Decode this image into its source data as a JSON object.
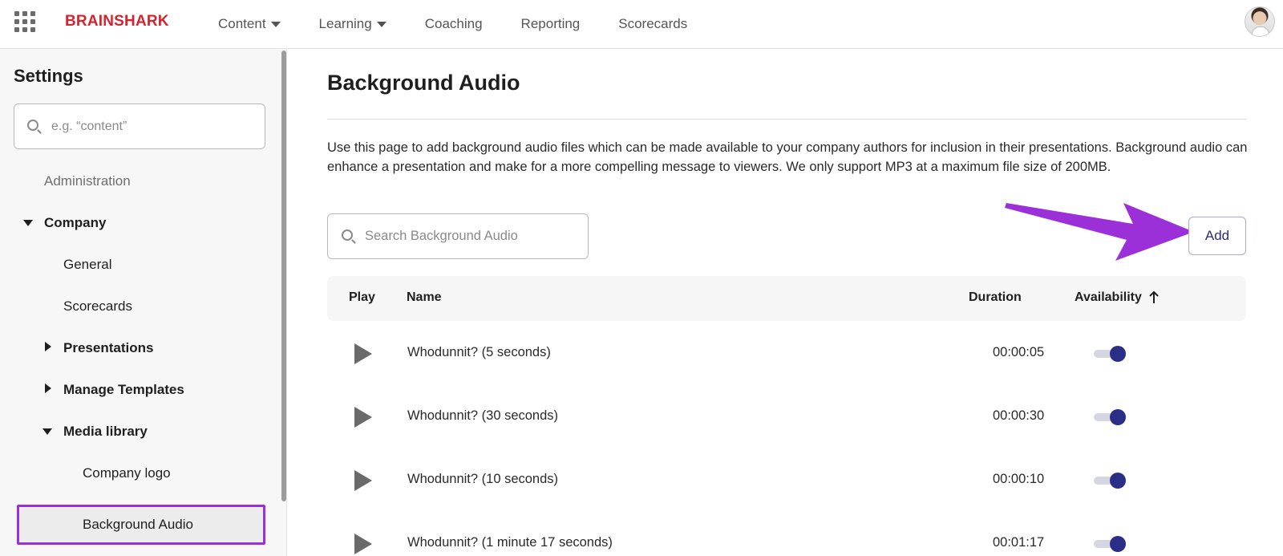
{
  "nav": {
    "brand": "BRAINSHARK",
    "items": [
      {
        "label": "Content",
        "has_caret": true
      },
      {
        "label": "Learning",
        "has_caret": true
      },
      {
        "label": "Coaching",
        "has_caret": false
      },
      {
        "label": "Reporting",
        "has_caret": false
      },
      {
        "label": "Scorecards",
        "has_caret": false
      }
    ],
    "icons": {
      "apps": "grid-icon",
      "avatar": "user-avatar"
    }
  },
  "sidebar": {
    "title": "Settings",
    "search_placeholder": "e.g. “content”",
    "items": {
      "administration": "Administration",
      "company": "Company",
      "general": "General",
      "scorecards": "Scorecards",
      "presentations": "Presentations",
      "manage_templates": "Manage Templates",
      "media_library": "Media library",
      "company_logo": "Company logo",
      "background_audio": "Background Audio"
    },
    "selected": "background_audio",
    "highlight_color": "#9b30d9"
  },
  "main": {
    "title": "Background Audio",
    "description": "Use this page to add background audio files which can be made available to your company authors for inclusion in their presentations. Background audio can enhance a presentation and make for a more compelling message to viewers. We only support MP3 at a maximum file size of 200MB.",
    "search_placeholder": "Search Background Audio",
    "add_label": "Add",
    "annotation_arrow_color": "#9b30d9",
    "table": {
      "headers": {
        "play": "Play",
        "name": "Name",
        "duration": "Duration",
        "availability": "Availability"
      },
      "sort_indicator": "arrow-up-icon",
      "rows": [
        {
          "name": "Whodunnit? (5 seconds)",
          "duration": "00:00:05",
          "available": true
        },
        {
          "name": "Whodunnit? (30 seconds)",
          "duration": "00:00:30",
          "available": true
        },
        {
          "name": "Whodunnit? (10 seconds)",
          "duration": "00:00:10",
          "available": true
        },
        {
          "name": "Whodunnit? (1 minute 17 seconds)",
          "duration": "00:01:17",
          "available": true
        }
      ]
    },
    "accent_color": "#2b2e86"
  }
}
